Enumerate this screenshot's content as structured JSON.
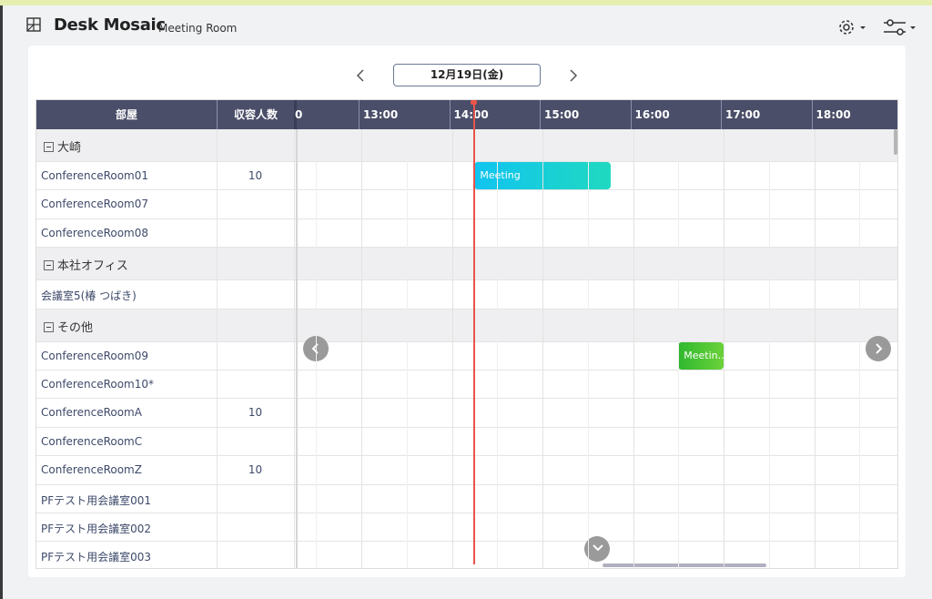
{
  "app": {
    "brand": "Desk Mosaic",
    "subtitle": "Meeting Room"
  },
  "date_nav": {
    "current_date": "12月19日(金)"
  },
  "columns": {
    "room_header": "部屋",
    "capacity_header": "収容人数"
  },
  "time_slots": [
    "0",
    "13:00",
    "14:00",
    "15:00",
    "16:00",
    "17:00",
    "18:00"
  ],
  "groups": [
    {
      "label": "大崎",
      "rooms": [
        {
          "name": "ConferenceRoom01",
          "capacity": "10"
        },
        {
          "name": "ConferenceRoom07",
          "capacity": ""
        },
        {
          "name": "ConferenceRoom08",
          "capacity": ""
        }
      ]
    },
    {
      "label": "本社オフィス",
      "rooms": [
        {
          "name": "会議室5(椿 つばき)",
          "capacity": ""
        }
      ]
    },
    {
      "label": "その他",
      "rooms": [
        {
          "name": "ConferenceRoom09",
          "capacity": ""
        },
        {
          "name": "ConferenceRoom10*",
          "capacity": ""
        },
        {
          "name": "ConferenceRoomA",
          "capacity": "10"
        },
        {
          "name": "ConferenceRoomC",
          "capacity": ""
        },
        {
          "name": "ConferenceRoomZ",
          "capacity": "10"
        },
        {
          "name": "PFテスト用会議室001",
          "capacity": ""
        },
        {
          "name": "PFテスト用会議室002",
          "capacity": ""
        },
        {
          "name": "PFテスト用会議室003",
          "capacity": ""
        }
      ]
    }
  ],
  "events": [
    {
      "label": "Meeting",
      "room": "ConferenceRoom01",
      "start": "14:15",
      "end": "15:45"
    },
    {
      "label": "Meetin...",
      "room": "ConferenceRoom09",
      "start": "16:30",
      "end": "17:00"
    }
  ],
  "colors": {
    "header_bg": "#4a4e69",
    "now_line": "#e8544a",
    "event_blue_start": "#10c4f0",
    "event_blue_end": "#20d9c0",
    "event_green_start": "#2fb82f",
    "event_green_end": "#6ad13a",
    "accent_strip": "#e6efb0"
  }
}
